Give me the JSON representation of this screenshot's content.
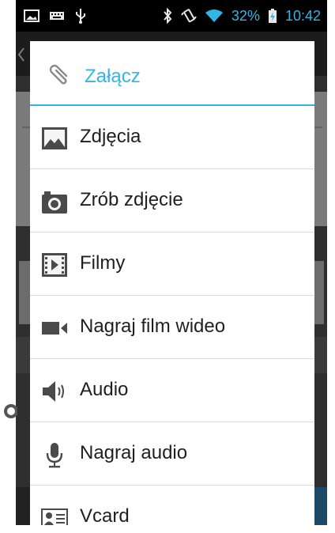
{
  "status_bar": {
    "battery_percent": "32%",
    "time": "10:42"
  },
  "dialog": {
    "title": "Załącz",
    "options": [
      {
        "label": "Zdjęcia",
        "icon": "picture-icon"
      },
      {
        "label": "Zrób zdjęcie",
        "icon": "camera-icon"
      },
      {
        "label": "Filmy",
        "icon": "film-icon"
      },
      {
        "label": "Nagraj film wideo",
        "icon": "video-camera-icon"
      },
      {
        "label": "Audio",
        "icon": "speaker-icon"
      },
      {
        "label": "Nagraj audio",
        "icon": "microphone-icon"
      },
      {
        "label": "Vcard",
        "icon": "contact-card-icon"
      }
    ]
  },
  "colors": {
    "accent": "#33b5e5",
    "text": "#1f1f1f",
    "divider": "#dcdcdc"
  }
}
